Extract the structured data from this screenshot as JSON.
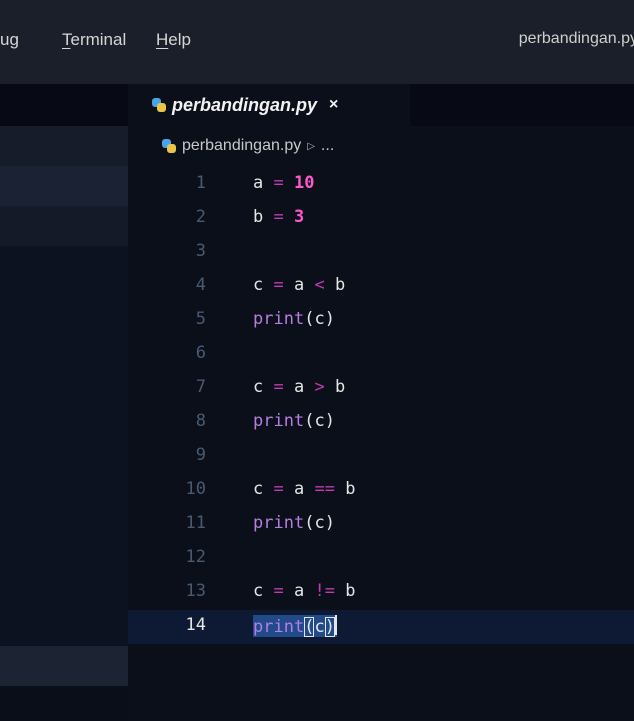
{
  "menu": {
    "debug_partial": "ug",
    "terminal_underlined": "T",
    "terminal_rest": "erminal",
    "help_underlined": "H",
    "help_rest": "elp",
    "window_title": "perbandingan.py"
  },
  "tab": {
    "label": "perbandingan.py",
    "close": "×",
    "icon": "python-icon"
  },
  "breadcrumb": {
    "file": "perbandingan.py",
    "chevron": "▷",
    "ellipsis": "..."
  },
  "lines": [
    {
      "n": "1"
    },
    {
      "n": "2"
    },
    {
      "n": "3"
    },
    {
      "n": "4"
    },
    {
      "n": "5"
    },
    {
      "n": "6"
    },
    {
      "n": "7"
    },
    {
      "n": "8"
    },
    {
      "n": "9"
    },
    {
      "n": "10"
    },
    {
      "n": "11"
    },
    {
      "n": "12"
    },
    {
      "n": "13"
    },
    {
      "n": "14"
    }
  ],
  "code": {
    "l1": {
      "var": "a",
      "op": "=",
      "num": "10"
    },
    "l2": {
      "var": "b",
      "op": "=",
      "num": "3"
    },
    "l4": {
      "var": "c",
      "op": "=",
      "lhs": "a",
      "cmp": "<",
      "rhs": "b"
    },
    "l7": {
      "var": "c",
      "op": "=",
      "lhs": "a",
      "cmp": ">",
      "rhs": "b"
    },
    "l10": {
      "var": "c",
      "op": "=",
      "lhs": "a",
      "cmp": "==",
      "rhs": "b"
    },
    "l13": {
      "var": "c",
      "op": "=",
      "lhs": "a",
      "cmp": "!=",
      "rhs": "b"
    },
    "print_fn": "print",
    "open_paren": "(",
    "arg": "c",
    "close_paren": ")"
  },
  "colors": {
    "background": "#0b0f1a",
    "operator": "#c43ab0",
    "number": "#ff56c8",
    "function": "#b67ee0",
    "current_line": "#0e1a33"
  }
}
